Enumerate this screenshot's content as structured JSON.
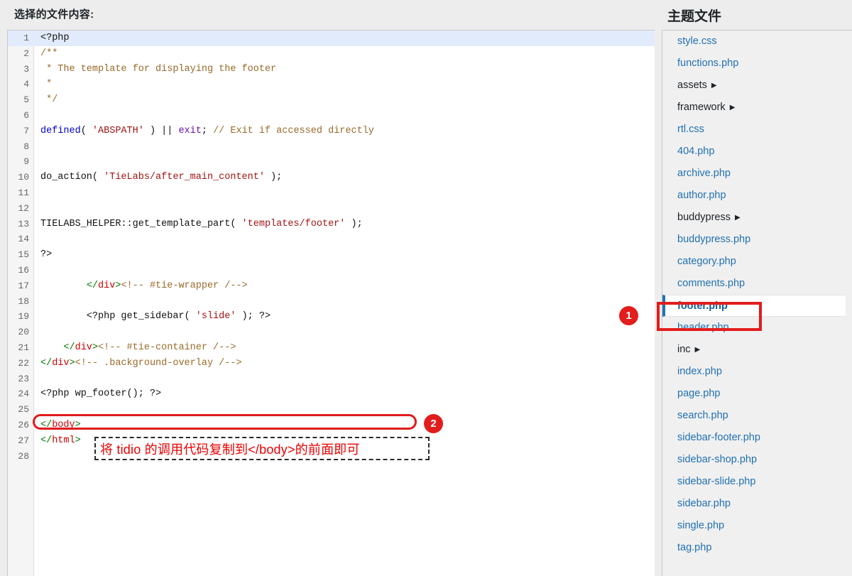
{
  "left_panel": {
    "title": "选择的文件内容:",
    "highlighted_line": 1,
    "lines": [
      {
        "n": "1",
        "tokens": [
          {
            "t": "<?php",
            "c": "t-plain"
          }
        ]
      },
      {
        "n": "2",
        "tokens": [
          {
            "t": "/**",
            "c": "t-cmt"
          }
        ]
      },
      {
        "n": "3",
        "tokens": [
          {
            "t": " * The template for displaying the footer",
            "c": "t-cmt"
          }
        ]
      },
      {
        "n": "4",
        "tokens": [
          {
            "t": " *",
            "c": "t-cmt"
          }
        ]
      },
      {
        "n": "5",
        "tokens": [
          {
            "t": " */",
            "c": "t-cmt"
          }
        ]
      },
      {
        "n": "6",
        "tokens": []
      },
      {
        "n": "7",
        "tokens": [
          {
            "t": "defined",
            "c": "t-kw"
          },
          {
            "t": "( ",
            "c": "t-plain"
          },
          {
            "t": "'ABSPATH'",
            "c": "t-str"
          },
          {
            "t": " ) || ",
            "c": "t-plain"
          },
          {
            "t": "exit",
            "c": "t-var"
          },
          {
            "t": "; ",
            "c": "t-plain"
          },
          {
            "t": "// Exit if accessed directly",
            "c": "t-cmt"
          }
        ]
      },
      {
        "n": "8",
        "tokens": []
      },
      {
        "n": "9",
        "tokens": []
      },
      {
        "n": "10",
        "tokens": [
          {
            "t": "do_action( ",
            "c": "t-plain"
          },
          {
            "t": "'TieLabs/after_main_content'",
            "c": "t-str"
          },
          {
            "t": " );",
            "c": "t-plain"
          }
        ]
      },
      {
        "n": "11",
        "tokens": []
      },
      {
        "n": "12",
        "tokens": []
      },
      {
        "n": "13",
        "tokens": [
          {
            "t": "TIELABS_HELPER::get_template_part( ",
            "c": "t-plain"
          },
          {
            "t": "'templates/footer'",
            "c": "t-str"
          },
          {
            "t": " );",
            "c": "t-plain"
          }
        ]
      },
      {
        "n": "14",
        "tokens": []
      },
      {
        "n": "15",
        "tokens": [
          {
            "t": "?>",
            "c": "t-plain"
          }
        ]
      },
      {
        "n": "16",
        "tokens": []
      },
      {
        "n": "17",
        "tokens": [
          {
            "t": "        ",
            "c": "t-plain"
          },
          {
            "t": "</",
            "c": "t-tagp"
          },
          {
            "t": "div",
            "c": "t-tag"
          },
          {
            "t": ">",
            "c": "t-tagp"
          },
          {
            "t": "<!-- #tie-wrapper /-->",
            "c": "t-htmlcmt"
          }
        ]
      },
      {
        "n": "18",
        "tokens": []
      },
      {
        "n": "19",
        "tokens": [
          {
            "t": "        <?php get_sidebar( ",
            "c": "t-plain"
          },
          {
            "t": "'slide'",
            "c": "t-str"
          },
          {
            "t": " ); ?>",
            "c": "t-plain"
          }
        ]
      },
      {
        "n": "20",
        "tokens": []
      },
      {
        "n": "21",
        "tokens": [
          {
            "t": "    ",
            "c": "t-plain"
          },
          {
            "t": "</",
            "c": "t-tagp"
          },
          {
            "t": "div",
            "c": "t-tag"
          },
          {
            "t": ">",
            "c": "t-tagp"
          },
          {
            "t": "<!-- #tie-container /-->",
            "c": "t-htmlcmt"
          }
        ]
      },
      {
        "n": "22",
        "tokens": [
          {
            "t": "</",
            "c": "t-tagp"
          },
          {
            "t": "div",
            "c": "t-tag"
          },
          {
            "t": ">",
            "c": "t-tagp"
          },
          {
            "t": "<!-- .background-overlay /-->",
            "c": "t-htmlcmt"
          }
        ]
      },
      {
        "n": "23",
        "tokens": []
      },
      {
        "n": "24",
        "tokens": [
          {
            "t": "<?php wp_footer(); ?>",
            "c": "t-plain"
          }
        ]
      },
      {
        "n": "25",
        "tokens": []
      },
      {
        "n": "26",
        "tokens": [
          {
            "t": "</",
            "c": "t-tagp"
          },
          {
            "t": "body",
            "c": "t-tag"
          },
          {
            "t": ">",
            "c": "t-tagp"
          }
        ]
      },
      {
        "n": "27",
        "tokens": [
          {
            "t": "</",
            "c": "t-tagp"
          },
          {
            "t": "html",
            "c": "t-tag"
          },
          {
            "t": ">",
            "c": "t-tagp"
          }
        ]
      },
      {
        "n": "28",
        "tokens": []
      }
    ]
  },
  "annotations": {
    "marker_1": "1",
    "marker_2": "2",
    "note_text": "将 tidio 的调用代码复制到</body>的前面即可",
    "accent_color": "#e31c1c"
  },
  "sidebar": {
    "title": "主题文件",
    "active_file": "footer.php",
    "items": [
      {
        "label": "style.css",
        "type": "file",
        "active": false
      },
      {
        "label": "functions.php",
        "type": "file",
        "active": false
      },
      {
        "label": "assets",
        "type": "folder",
        "active": false
      },
      {
        "label": "framework",
        "type": "folder",
        "active": false
      },
      {
        "label": "rtl.css",
        "type": "file",
        "active": false
      },
      {
        "label": "404.php",
        "type": "file",
        "active": false
      },
      {
        "label": "archive.php",
        "type": "file",
        "active": false
      },
      {
        "label": "author.php",
        "type": "file",
        "active": false
      },
      {
        "label": "buddypress",
        "type": "folder",
        "active": false
      },
      {
        "label": "buddypress.php",
        "type": "file",
        "active": false
      },
      {
        "label": "category.php",
        "type": "file",
        "active": false
      },
      {
        "label": "comments.php",
        "type": "file",
        "active": false
      },
      {
        "label": "footer.php",
        "type": "file",
        "active": true
      },
      {
        "label": "header.php",
        "type": "file",
        "active": false
      },
      {
        "label": "inc",
        "type": "folder",
        "active": false
      },
      {
        "label": "index.php",
        "type": "file",
        "active": false
      },
      {
        "label": "page.php",
        "type": "file",
        "active": false
      },
      {
        "label": "search.php",
        "type": "file",
        "active": false
      },
      {
        "label": "sidebar-footer.php",
        "type": "file",
        "active": false
      },
      {
        "label": "sidebar-shop.php",
        "type": "file",
        "active": false
      },
      {
        "label": "sidebar-slide.php",
        "type": "file",
        "active": false
      },
      {
        "label": "sidebar.php",
        "type": "file",
        "active": false
      },
      {
        "label": "single.php",
        "type": "file",
        "active": false
      },
      {
        "label": "tag.php",
        "type": "file",
        "active": false
      }
    ],
    "folder_caret_icon": "caret-right-icon"
  }
}
